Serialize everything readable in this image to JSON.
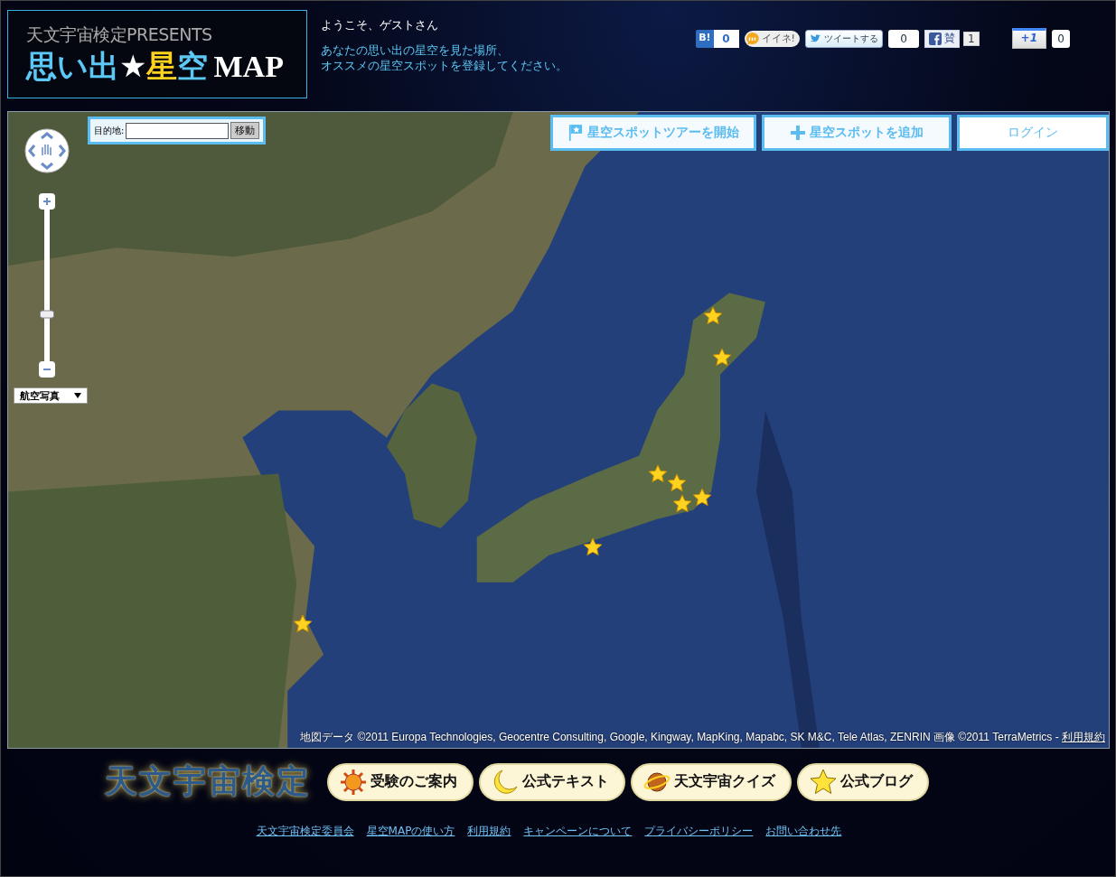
{
  "header": {
    "logo": {
      "subtitle": "天文宇宙検定PRESENTS",
      "title_parts": [
        {
          "text": "思い出",
          "color": "#5cc8f5"
        },
        {
          "text": "★",
          "color": "#ffffff"
        },
        {
          "text": "星",
          "color": "#ffd21f"
        },
        {
          "text": "空",
          "color": "#5cc8f5"
        },
        {
          "text": "MAP",
          "color": "#ffffff"
        }
      ]
    },
    "welcome": "ようこそ、ゲストさん",
    "message_lines": [
      "あなたの思い出の星空を見た場所、",
      "オススメの星空スポットを登録してください。"
    ],
    "social": [
      {
        "kind": "hatena",
        "label": "B!",
        "count": "0"
      },
      {
        "kind": "mixi",
        "label": "イイネ!"
      },
      {
        "kind": "tweet",
        "label": "ツイートする",
        "count": "0"
      },
      {
        "kind": "facebook",
        "label": "賛",
        "count": "1"
      },
      {
        "kind": "gplus",
        "label": "+1",
        "count": "0"
      }
    ]
  },
  "map": {
    "search": {
      "label": "目的地:",
      "button": "移動"
    },
    "zoom": {
      "level": 0.31
    },
    "map_type": "航空写真",
    "actions": [
      {
        "kind": "tour",
        "label": "星空スポットツアーを開始"
      },
      {
        "kind": "add",
        "label": "星空スポットを追加"
      },
      {
        "kind": "login",
        "label": "ログイン"
      }
    ],
    "attribution": "地図データ ©2011 Europa Technologies, Geocentre Consulting, Google, Kingway, MapKing, Mapabc, SK M&C, Tele Atlas, ZENRIN 画像 ©2011 TerraMetrics - ",
    "terms_link": "利用規約"
  },
  "footer": {
    "logo": "天文宇宙検定",
    "nav": [
      {
        "kind": "sun",
        "label": "受験のご案内"
      },
      {
        "kind": "moon",
        "label": "公式テキスト"
      },
      {
        "kind": "planet",
        "label": "天文宇宙クイズ"
      },
      {
        "kind": "star",
        "label": "公式ブログ"
      }
    ],
    "links": [
      "天文宇宙検定委員会",
      "星空MAPの使い方",
      "利用規約",
      "キャンペーンについて",
      "プライバシーポリシー",
      "お問い合わせ先"
    ]
  }
}
